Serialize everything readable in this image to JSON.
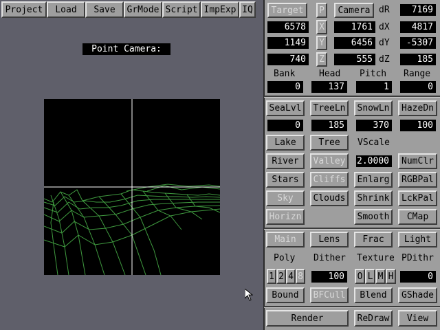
{
  "menu": {
    "project": "Project",
    "load": "Load",
    "save": "Save",
    "grmode": "GrMode",
    "script": "Script",
    "impexp": "ImpExp",
    "iq": "IQ"
  },
  "camera_title": "Point Camera:",
  "coords": {
    "target_label": "Target",
    "p_label": "P",
    "camera_label": "Camera",
    "dr_label": "dR",
    "dr_value": "7169",
    "x_label": "X",
    "target_x": "6578",
    "camera_x": "1761",
    "dx_label": "dX",
    "dx_value": "4817",
    "y_label": "Y",
    "target_y": "1149",
    "camera_y": "6456",
    "dy_label": "dY",
    "dy_value": "-5307",
    "z_label": "Z",
    "target_z": "740",
    "camera_z": "555",
    "dz_label": "dZ",
    "dz_value": "185"
  },
  "orientation": {
    "bank_label": "Bank",
    "bank_value": "0",
    "head_label": "Head",
    "head_value": "137",
    "pitch_label": "Pitch",
    "pitch_value": "1",
    "range_label": "Range",
    "range_value": "0"
  },
  "levels": {
    "sealvl": "SeaLvl",
    "sealvl_value": "0",
    "treeln": "TreeLn",
    "treeln_value": "185",
    "snowln": "SnowLn",
    "snowln_value": "370",
    "hazedn": "HazeDn",
    "hazedn_value": "100"
  },
  "features": {
    "lake": "Lake",
    "tree": "Tree",
    "vscale_label": "VScale",
    "vscale_value": "2.0000",
    "river": "River",
    "valley": "Valley",
    "numclr": "NumClr",
    "stars": "Stars",
    "cliffs": "Cliffs",
    "enlarg": "Enlarg",
    "rgbpal": "RGBPal",
    "sky": "Sky",
    "clouds": "Clouds",
    "shrink": "Shrink",
    "lckpal": "LckPal",
    "horizn": "Horizn",
    "smooth": "Smooth",
    "cmap": "CMap"
  },
  "modes": {
    "main": "Main",
    "lens": "Lens",
    "frac": "Frac",
    "light": "Light"
  },
  "render_opts": {
    "poly_label": "Poly",
    "dither_label": "Dither",
    "dither_value": "100",
    "texture_label": "Texture",
    "pdithr_label": "PDithr",
    "pdithr_value": "0",
    "poly_1": "1",
    "poly_2": "2",
    "poly_4": "4",
    "poly_8": "8",
    "tex_o": "O",
    "tex_l": "L",
    "tex_m": "M",
    "tex_h": "H"
  },
  "bottom": {
    "bound": "Bound",
    "bfcull": "BFCull",
    "blend": "Blend",
    "gshade": "GShade",
    "render": "Render",
    "redraw": "ReDraw",
    "view": "View"
  },
  "colors": {
    "background": "#5f5f6a",
    "panel": "#9e9e9e",
    "terrain": "#3f9a3f",
    "crosshair": "#ffffff"
  }
}
